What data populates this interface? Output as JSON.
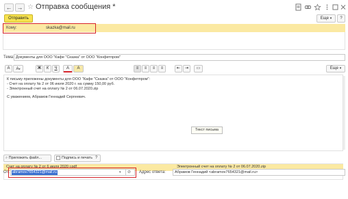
{
  "window": {
    "title": "Отправка сообщения *",
    "back_glyph": "←",
    "forward_glyph": "→",
    "star_glyph": "☆"
  },
  "toolbar": {
    "send_label": "Отправить",
    "more_label": "Еще",
    "help_label": "?"
  },
  "recipients": {
    "to_label": "Кому:",
    "to_value": "skazka@mail.ru"
  },
  "subject": {
    "label": "Тема:",
    "value": "Документы для ООО \"Кафе \"Сказка\" от ООО \"Конфетпром\""
  },
  "format_toolbar": {
    "buttons": [
      "A",
      "A",
      "Ж",
      "К",
      "Ч",
      "A",
      "A",
      "≡",
      "≡",
      "≡",
      "≡",
      "⇤",
      "⇥",
      "▭"
    ],
    "more_label": "Еще"
  },
  "message": {
    "lines": [
      "К письму приложены документы для ООО \"Кафе \"Сказка\" от ООО \"Конфетпром\":",
      "- Счет на оплату № 2 от 06 июля 2020 г. на сумму 150,00 руб.",
      "- Электронный счет на оплату № 2 от 06.07.2020.zip",
      "",
      "С уважением, Абрамов Геннадий Сергеевич."
    ],
    "tooltip": "Текст письма"
  },
  "attachments": {
    "attach_label": "Приложить файл...",
    "sign_label": "Подпись и печать",
    "help_label": "?",
    "files": [
      "Счет на оплату № 2 от 6 июля 2020 г.pdf",
      "Электронный счет на оплату № 2 от 06.07.2020.zip"
    ]
  },
  "from": {
    "label": "От:",
    "value": "abramov7654321@mail.ru"
  },
  "reply": {
    "label": "Адрес ответа:",
    "value": "Абрамов Геннадий <abramov7654321@mail.ru>"
  },
  "colors": {
    "accent_yellow": "#f6e250",
    "highlight_band": "#fbe9a2",
    "callout_red": "#d6232a",
    "selection_blue": "#3a6fd0"
  }
}
